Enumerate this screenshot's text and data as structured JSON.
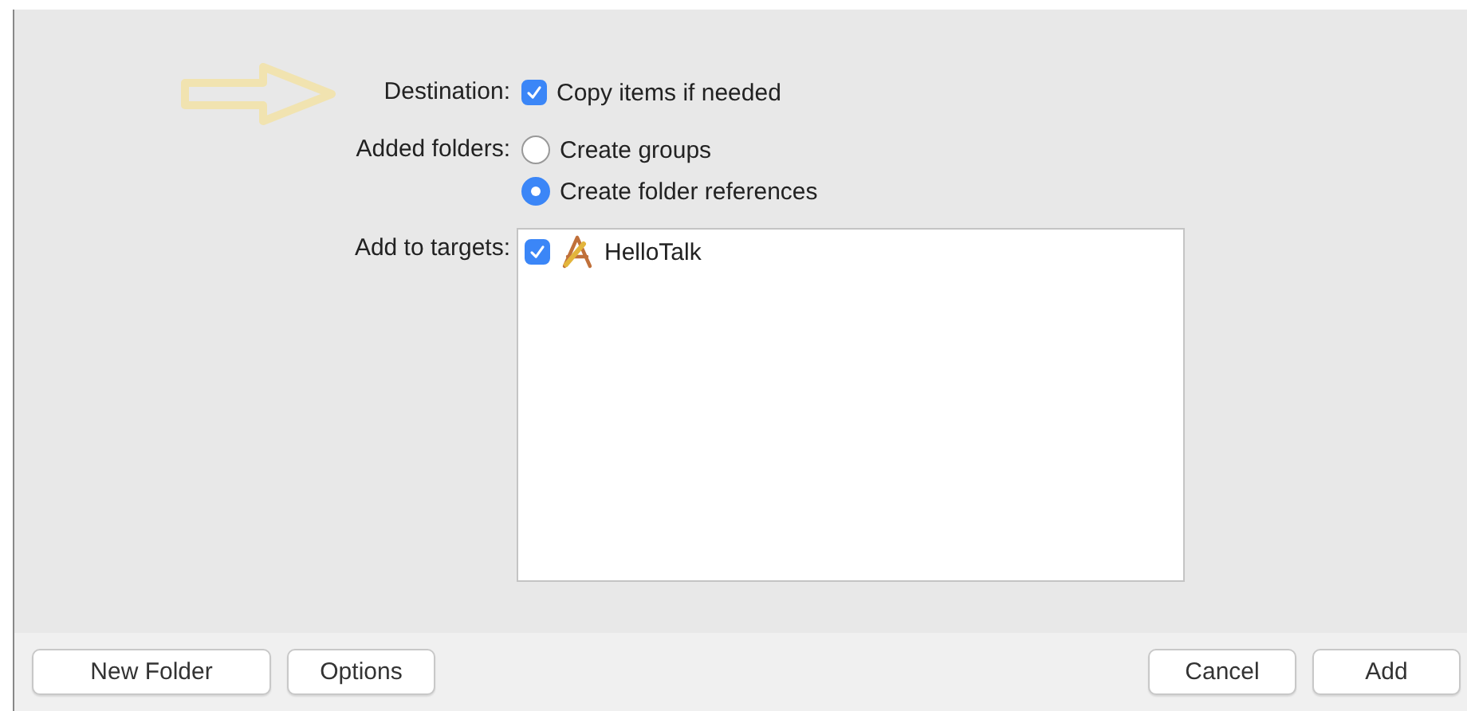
{
  "options": [
    {
      "label": "Destination:",
      "kind": "checkbox",
      "controls": [
        {
          "text": "Copy items if needed",
          "checked": true
        }
      ]
    },
    {
      "label": "Added folders:",
      "kind": "radio",
      "controls": [
        {
          "text": "Create groups",
          "selected": false
        },
        {
          "text": "Create folder references",
          "selected": true
        }
      ]
    }
  ],
  "targets": {
    "label": "Add to targets:",
    "items": [
      {
        "name": "HelloTalk",
        "checked": true
      }
    ]
  },
  "buttons_left": [
    "New Folder",
    "Options"
  ],
  "buttons_right": [
    "Cancel",
    "Add"
  ]
}
